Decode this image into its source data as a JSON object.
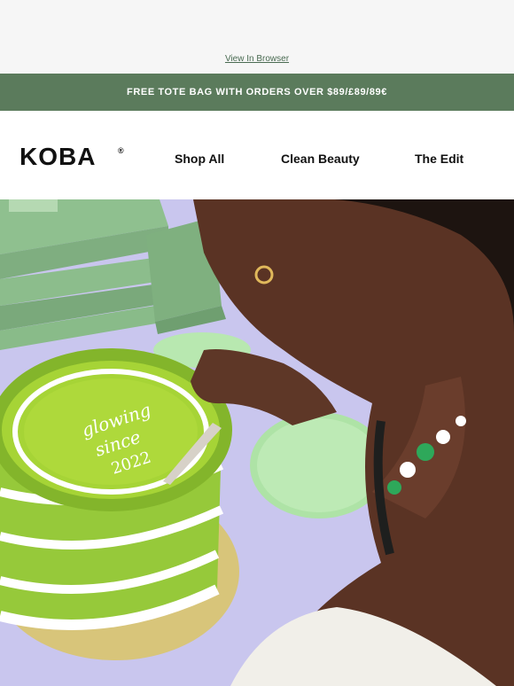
{
  "top": {
    "view_in_browser": "View In Browser"
  },
  "promo": {
    "text": "FREE TOTE BAG WITH ORDERS OVER $89/£89/89€"
  },
  "header": {
    "logo": "KOBA",
    "logo_mark": "®",
    "nav": [
      {
        "label": "Shop All"
      },
      {
        "label": "Clean Beauty"
      },
      {
        "label": "The Edit"
      }
    ]
  },
  "hero": {
    "cake_text_line1": "glowing",
    "cake_text_line2": "since",
    "cake_text_line3": "2022"
  },
  "colors": {
    "promo_bg": "#5b7b5c",
    "cake_green": "#9acd32",
    "table": "#c7c4ec",
    "box_green": "#86b98a"
  }
}
